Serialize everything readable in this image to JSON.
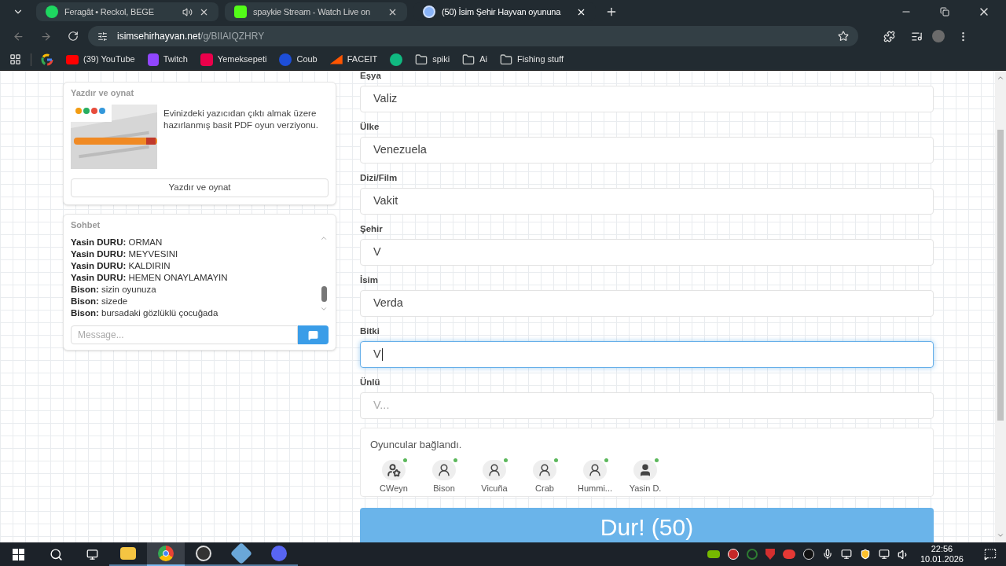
{
  "browser": {
    "tabs": [
      {
        "kind": "spotify",
        "title": "Feragât • Reckol, BEGE",
        "audio": true,
        "selected": false
      },
      {
        "kind": "kick",
        "title": "spaykie Stream - Watch Live on",
        "audio": false,
        "selected": false
      },
      {
        "kind": "site",
        "title": "(50) İsim Şehir Hayvan oyununa",
        "audio": false,
        "selected": true
      }
    ],
    "address": {
      "host": "isimsehirhayvan.net",
      "path": "/g/BIIAIQZHRY"
    },
    "bookmarks": [
      {
        "kind": "google"
      },
      {
        "kind": "youtube",
        "label": "(39) YouTube"
      },
      {
        "kind": "twitch",
        "label": "Twitch"
      },
      {
        "kind": "yemeksepeti",
        "label": "Yemeksepeti"
      },
      {
        "kind": "coub",
        "label": "Coub"
      },
      {
        "kind": "faceit",
        "label": "FACEIT"
      },
      {
        "kind": "shield"
      },
      {
        "kind": "folder",
        "label": "spiki"
      },
      {
        "kind": "folder",
        "label": "Ai"
      },
      {
        "kind": "folder",
        "label": "Fishing stuff"
      }
    ]
  },
  "print_card": {
    "title": "Yazdır ve oynat",
    "description": "Evinizdeki yazıcıdan çıktı almak üzere hazırlanmış basit PDF oyun verziyonu.",
    "button": "Yazdır ve oynat"
  },
  "chat": {
    "title": "Sohbet",
    "messages": [
      {
        "author": "Yasin DURU:",
        "text": "ORMAN"
      },
      {
        "author": "Yasin DURU:",
        "text": "MEYVESINI"
      },
      {
        "author": "Yasin DURU:",
        "text": "KALDIRIN"
      },
      {
        "author": "Yasin DURU:",
        "text": "HEMEN ONAYLAMAYIN"
      },
      {
        "author": "Bison:",
        "text": "sizin oyunuza"
      },
      {
        "author": "Bison:",
        "text": "sizede"
      },
      {
        "author": "Bison:",
        "text": "bursadaki gözlüklü çocuğada"
      }
    ],
    "placeholder": "Message..."
  },
  "fields": [
    {
      "label": "Eşya",
      "value": "Valiz",
      "focused": false
    },
    {
      "label": "Ülke",
      "value": "Venezuela",
      "focused": false
    },
    {
      "label": "Dizi/Film",
      "value": "Vakit",
      "focused": false
    },
    {
      "label": "Şehir",
      "value": "V",
      "focused": false
    },
    {
      "label": "İsim",
      "value": "Verda",
      "focused": false
    },
    {
      "label": "Bitki",
      "value": "V",
      "focused": true
    },
    {
      "label": "Ünlü",
      "placeholder": "V...",
      "focused": false
    }
  ],
  "players": {
    "title": "Oyuncular bağlandı.",
    "items": [
      {
        "name": "CWeyn",
        "kind": "host",
        "online": true
      },
      {
        "name": "Bison",
        "kind": "guest",
        "online": true
      },
      {
        "name": "Vicuña",
        "kind": "guest",
        "online": true
      },
      {
        "name": "Crab",
        "kind": "guest",
        "online": true
      },
      {
        "name": "Hummi...",
        "kind": "guest",
        "online": true
      },
      {
        "name": "Yasin D.",
        "kind": "member",
        "online": true
      }
    ]
  },
  "stop_button": "Dur! (50)",
  "taskbar": {
    "apps": [
      {
        "kind": "explorer",
        "active": false
      },
      {
        "kind": "chrome",
        "active": true
      },
      {
        "kind": "obs",
        "active": false
      },
      {
        "kind": "network",
        "active": false
      },
      {
        "kind": "discord",
        "active": false
      }
    ],
    "time": "22:56",
    "date": "10.01.2026"
  }
}
